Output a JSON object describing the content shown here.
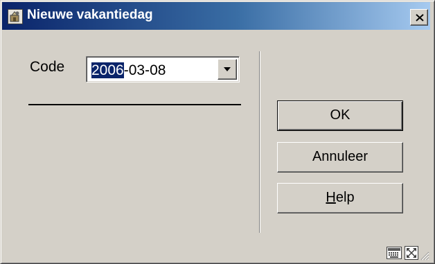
{
  "window": {
    "title": "Nieuwe vakantiedag",
    "close_icon": "close-x-icon"
  },
  "form": {
    "code_label": "Code",
    "code_value_selected": "2006",
    "code_value_rest": "-03-08",
    "dropdown_icon": "chevron-down-icon"
  },
  "buttons": {
    "ok_label": "OK",
    "cancel_label": "Annuleer",
    "help_prefix": "H",
    "help_rest": "elp"
  },
  "status_icons": [
    "keyboard-icon",
    "fullscreen-icon",
    "resize-grip-icon"
  ],
  "colors": {
    "title_bar_start": "#0a246a",
    "title_bar_end": "#a6caf0",
    "window_face": "#d4d0c8",
    "selection": "#0a246a"
  }
}
